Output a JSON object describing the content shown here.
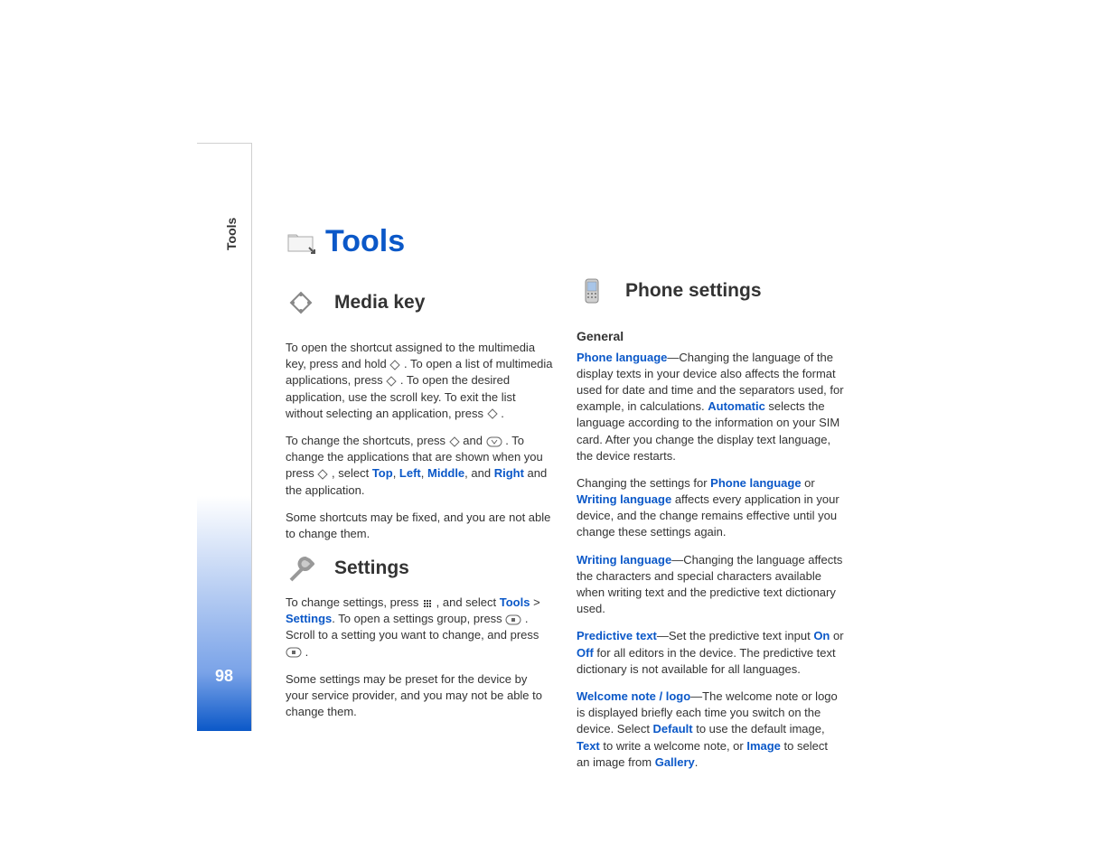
{
  "sidebar": {
    "label": "Tools",
    "page_number": "98"
  },
  "title": "Tools",
  "left_column": {
    "section1": {
      "heading": "Media key",
      "p1a": "To open the shortcut assigned to the multimedia key, press and hold ",
      "p1b": ". To open a list of multimedia applications, press ",
      "p1c": ". To open the desired application, use the scroll key. To exit the list without selecting an application, press ",
      "p1d": ".",
      "p2a": "To change the shortcuts, press ",
      "p2b": " and ",
      "p2c": ". To change the applications that are shown when you press ",
      "p2d": ", select ",
      "ui_top": "Top",
      "sep1": ", ",
      "ui_left": "Left",
      "sep2": ", ",
      "ui_middle": "Middle",
      "sep3": ", and ",
      "ui_right": "Right",
      "p2e": " and the application.",
      "p3": "Some shortcuts may be fixed, and you are not able to change them."
    },
    "section2": {
      "heading": "Settings",
      "p1a": "To change settings, press ",
      "p1b": ", and select ",
      "ui_tools": "Tools",
      "gt": " > ",
      "ui_settings": "Settings",
      "p1c": ". To open a settings group, press ",
      "p1d": ". Scroll to a setting you want to change, and press ",
      "p1e": ".",
      "p2": "Some settings may be preset for the device by your service provider, and you may not be able to change them."
    }
  },
  "right_column": {
    "heading": "Phone settings",
    "subheading": "General",
    "para1": {
      "ui1": "Phone language",
      "t1": "—Changing the language of the display texts in your device also affects the format used for date and time and the separators used, for example, in calculations. ",
      "ui2": "Automatic",
      "t2": " selects the language according to the information on your SIM card. After you change the display text language, the device restarts."
    },
    "para2": {
      "t1": "Changing the settings for ",
      "ui1": "Phone language",
      "t2": " or ",
      "ui2": "Writing language",
      "t3": " affects every application in your device, and the change remains effective until you change these settings again."
    },
    "para3": {
      "ui1": "Writing language",
      "t1": "—Changing the language affects the characters and special characters available when writing text and the predictive text dictionary used."
    },
    "para4": {
      "ui1": "Predictive text",
      "t1": "—Set the predictive text input ",
      "ui2": "On",
      "t2": " or ",
      "ui3": "Off",
      "t3": " for all editors in the device. The predictive text dictionary is not available for all languages."
    },
    "para5": {
      "ui1": "Welcome note / logo",
      "t1": "—The welcome note or logo is displayed briefly each time you switch on the device. Select ",
      "ui2": "Default",
      "t2": " to use the default image, ",
      "ui3": "Text",
      "t3": " to write a welcome note, or ",
      "ui4": "Image",
      "t4": " to select an image from ",
      "ui5": "Gallery",
      "t5": "."
    }
  }
}
